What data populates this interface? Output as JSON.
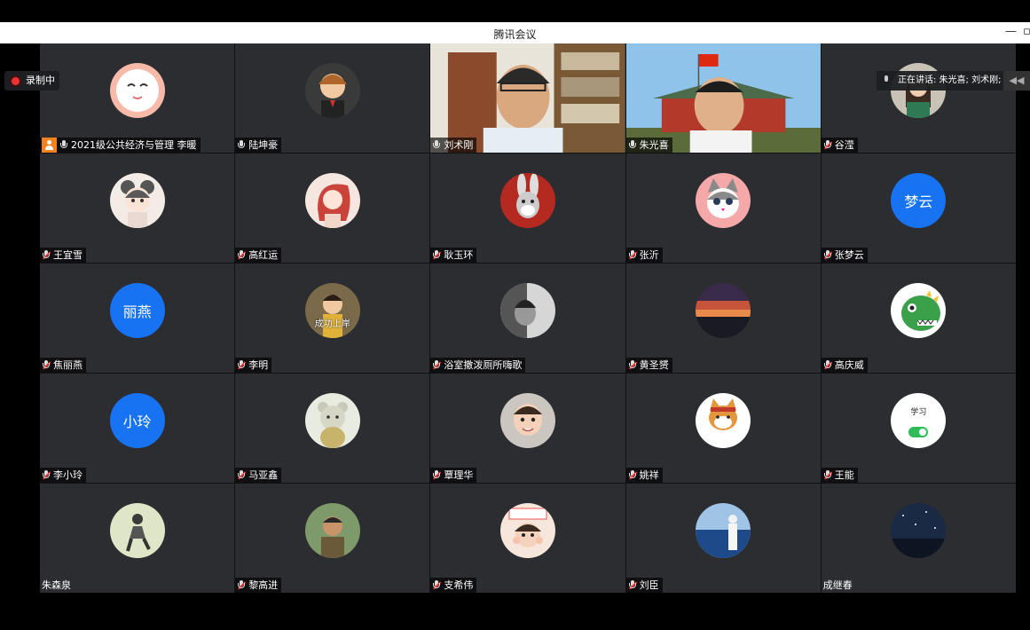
{
  "window": {
    "title": "腾讯会议"
  },
  "recording": {
    "label": "录制中"
  },
  "speaking": {
    "label": "正在讲话: 朱光喜; 刘术刚;"
  },
  "participants": [
    {
      "name": "2021级公共经济与管理 李暖",
      "host": true,
      "muted": false,
      "avatar": "smiley-face-avatar"
    },
    {
      "name": "陆坤豪",
      "muted": false,
      "avatar": "cartoon-boy-avatar"
    },
    {
      "name": "刘术刚",
      "muted": false,
      "video": true,
      "avatar": "video-man-bookshelf"
    },
    {
      "name": "朱光喜",
      "muted": false,
      "video": true,
      "avatar": "video-man-palace"
    },
    {
      "name": "谷滢",
      "muted": true,
      "avatar": "girl-photo-avatar"
    },
    {
      "name": "王宜雪",
      "muted": true,
      "avatar": "anime-girl-avatar"
    },
    {
      "name": "高红运",
      "muted": true,
      "avatar": "redhair-girl-avatar"
    },
    {
      "name": "耿玉环",
      "muted": true,
      "avatar": "rabbit-cartoon-avatar"
    },
    {
      "name": "张沂",
      "muted": true,
      "avatar": "kitten-avatar"
    },
    {
      "name": "张梦云",
      "muted": true,
      "avatar_text": "梦云"
    },
    {
      "name": "焦丽燕",
      "muted": true,
      "avatar_text": "丽燕"
    },
    {
      "name": "李明",
      "muted": true,
      "avatar": "child-avatar",
      "caption": "成功上岸"
    },
    {
      "name": "浴室撒泼厕所嗨歌",
      "muted": true,
      "avatar": "bw-photo-avatar"
    },
    {
      "name": "黄圣赟",
      "muted": true,
      "avatar": "sunset-avatar"
    },
    {
      "name": "高庆威",
      "muted": true,
      "avatar": "dinosaur-avatar"
    },
    {
      "name": "李小玲",
      "muted": true,
      "avatar_text": "小玲"
    },
    {
      "name": "马亚鑫",
      "muted": true,
      "avatar": "bear-doll-avatar"
    },
    {
      "name": "覃理华",
      "muted": true,
      "avatar": "baby-avatar"
    },
    {
      "name": "姚祥",
      "muted": true,
      "avatar": "shiba-dog-avatar"
    },
    {
      "name": "王能",
      "muted": true,
      "avatar": "study-toggle-avatar",
      "toggle_label": "学习"
    },
    {
      "name": "朱森泉",
      "muted": null,
      "avatar": "person-sketch-avatar"
    },
    {
      "name": "黎高进",
      "muted": true,
      "avatar": "outdoor-man-avatar"
    },
    {
      "name": "支希伟",
      "muted": true,
      "avatar": "girl-sign-avatar"
    },
    {
      "name": "刘臣",
      "muted": true,
      "avatar": "seaside-avatar"
    },
    {
      "name": "成继春",
      "muted": null,
      "avatar": "night-sky-avatar"
    }
  ],
  "colors": {
    "tile_bg": "#2b2d31",
    "text_avatar_bg": "#1873f2",
    "host_badge": "#f58220",
    "muted_slash": "#e33333",
    "recording_dot": "#e33333"
  }
}
